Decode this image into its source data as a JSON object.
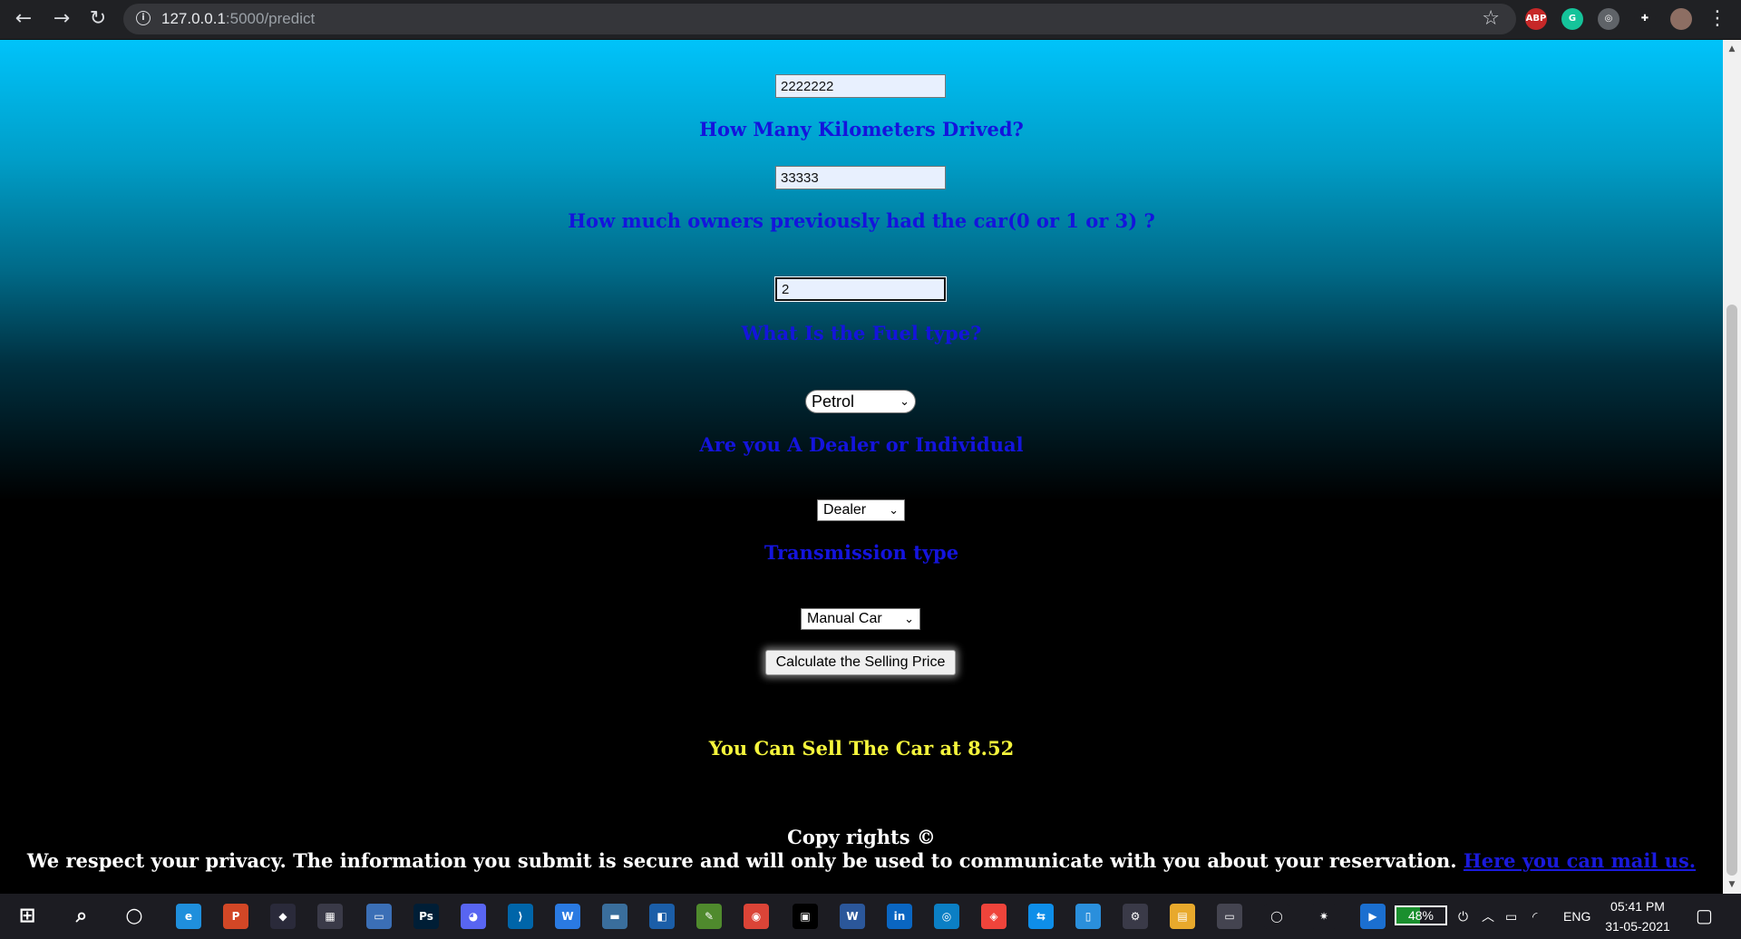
{
  "browser": {
    "url_host": "127.0.0.1",
    "url_path": ":5000/predict",
    "nav": {
      "back": "←",
      "forward": "→",
      "reload": "↻"
    },
    "extensions": [
      {
        "name": "adblock-icon",
        "label": "ABP",
        "color": "#c62828"
      },
      {
        "name": "grammarly-icon",
        "label": "G",
        "color": "#15c39a"
      },
      {
        "name": "extension-icon",
        "label": "◎",
        "color": "#5f6368"
      },
      {
        "name": "puzzle-icon",
        "label": "✚",
        "color": "#202124"
      },
      {
        "name": "profile-avatar-icon",
        "label": "",
        "color": "#8d6e63"
      }
    ]
  },
  "form": {
    "price_value": "2222222",
    "km_label": "How Many Kilometers Drived?",
    "km_value": "33333",
    "owners_label": "How much owners previously had the car(0 or 1 or 3) ?",
    "owners_value": "2",
    "fuel_label": "What Is the Fuel type?",
    "fuel_selected": "Petrol",
    "seller_label": "Are you A Dealer or Individual",
    "seller_selected": "Dealer",
    "transmission_label": "Transmission type",
    "transmission_selected": "Manual Car",
    "submit_label": "Calculate the Selling Price"
  },
  "result": {
    "text": "You Can Sell The Car at 8.52"
  },
  "footer": {
    "copyright": "Copy rights ©",
    "privacy": "We respect your privacy. The information you submit is secure and will only be used to communicate with you about your reservation.",
    "mail_link": "Here you can mail us."
  },
  "taskbar": {
    "icons": [
      {
        "name": "windows-start-icon",
        "label": "⊞",
        "color": "transparent"
      },
      {
        "name": "search-icon",
        "label": "⌕",
        "color": "transparent"
      },
      {
        "name": "cortana-icon",
        "label": "○",
        "color": "transparent"
      },
      {
        "name": "edge-icon",
        "label": "e",
        "color": "#1f8fdc"
      },
      {
        "name": "powerpoint-icon",
        "label": "P",
        "color": "#d24726"
      },
      {
        "name": "flow-app-icon",
        "label": "◆",
        "color": "#2a2a3a"
      },
      {
        "name": "store-icon",
        "label": "▦",
        "color": "#3a3a48"
      },
      {
        "name": "laptop-icon",
        "label": "▭",
        "color": "#3b6fb6"
      },
      {
        "name": "photoshop-icon",
        "label": "Ps",
        "color": "#001e36"
      },
      {
        "name": "discord-icon",
        "label": "◕",
        "color": "#5865f2"
      },
      {
        "name": "vscode-icon",
        "label": "⟩",
        "color": "#0065a9"
      },
      {
        "name": "app-w-icon",
        "label": "W",
        "color": "#2a7ae2"
      },
      {
        "name": "keyboard-app-icon",
        "label": "▬",
        "color": "#3a6e9c"
      },
      {
        "name": "app-square-icon",
        "label": "◧",
        "color": "#1b5ea8"
      },
      {
        "name": "notepad-icon",
        "label": "✎",
        "color": "#4f8a2d"
      },
      {
        "name": "chrome-icon",
        "label": "◉",
        "color": "#db4437"
      },
      {
        "name": "imdb-icon",
        "label": "▣",
        "color": "#000000"
      },
      {
        "name": "word-icon",
        "label": "W",
        "color": "#2b579a"
      },
      {
        "name": "linkedin-icon",
        "label": "in",
        "color": "#0a66c2"
      },
      {
        "name": "app-camera-icon",
        "label": "◎",
        "color": "#0b7fc4"
      },
      {
        "name": "anydesk-icon",
        "label": "◈",
        "color": "#ef443b"
      },
      {
        "name": "teamviewer-icon",
        "label": "⇆",
        "color": "#0e8ee9"
      },
      {
        "name": "phone-app-icon",
        "label": "▯",
        "color": "#2a8fdc"
      },
      {
        "name": "settings-gear-icon",
        "label": "⚙",
        "color": "#3a3a48"
      },
      {
        "name": "file-explorer-icon",
        "label": "▤",
        "color": "#e8a92c"
      },
      {
        "name": "terminal-icon",
        "label": "▭",
        "color": "#444450"
      },
      {
        "name": "circle-app-icon",
        "label": "◯",
        "color": "#1c1c22"
      },
      {
        "name": "network-app-icon",
        "label": "✷",
        "color": "#1c1c22"
      },
      {
        "name": "media-player-icon",
        "label": "▶",
        "color": "#1b6fd0"
      }
    ],
    "battery_text": "48%",
    "battery_level": 0.48,
    "language": "ENG",
    "time": "05:41 PM",
    "date": "31-05-2021"
  }
}
